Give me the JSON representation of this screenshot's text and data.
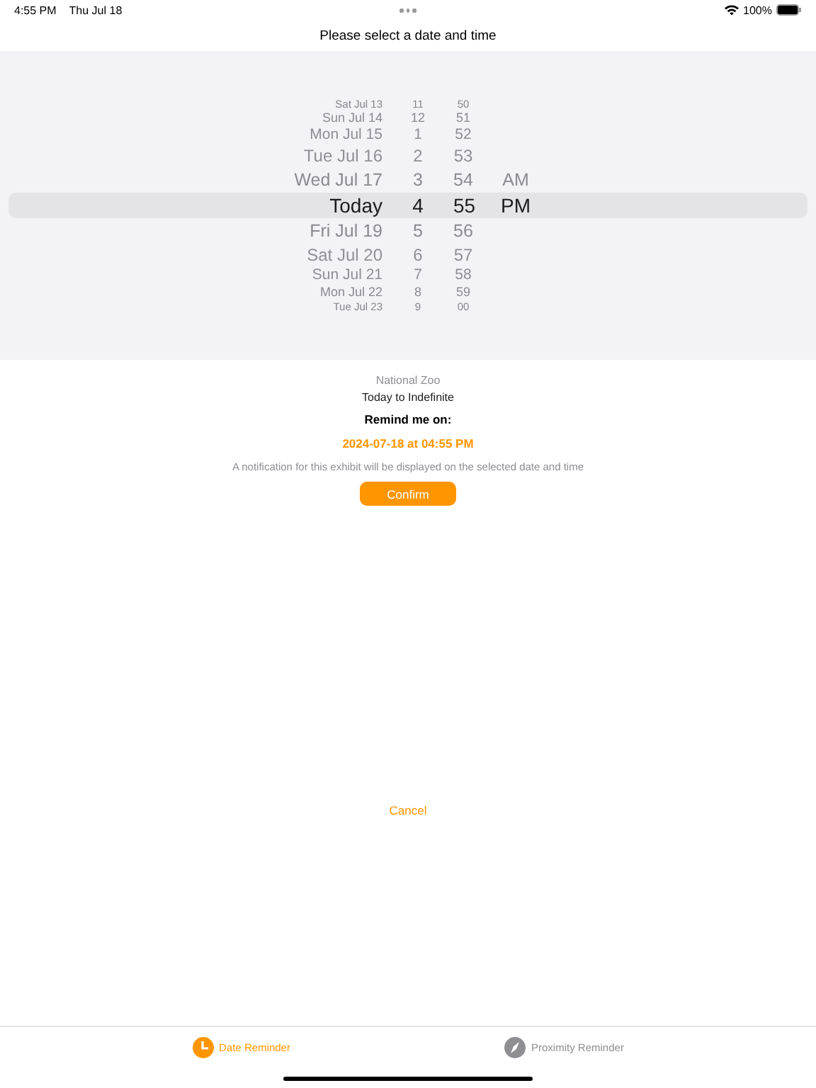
{
  "status_bar": {
    "time": "4:55 PM",
    "date": "Thu Jul 18",
    "battery": "100%"
  },
  "title": "Please select a date and time",
  "picker": {
    "rows": [
      {
        "date": "Sat Jul 13",
        "hour": "11",
        "minute": "50",
        "period": "",
        "selected": false
      },
      {
        "date": "Sun Jul 14",
        "hour": "12",
        "minute": "51",
        "period": "",
        "selected": false
      },
      {
        "date": "Mon Jul 15",
        "hour": "1",
        "minute": "52",
        "period": "",
        "selected": false
      },
      {
        "date": "Tue Jul 16",
        "hour": "2",
        "minute": "53",
        "period": "",
        "selected": false
      },
      {
        "date": "Wed Jul 17",
        "hour": "3",
        "minute": "54",
        "period": "AM",
        "selected": false
      },
      {
        "date": "Today",
        "hour": "4",
        "minute": "55",
        "period": "PM",
        "selected": true
      },
      {
        "date": "Fri Jul 19",
        "hour": "5",
        "minute": "56",
        "period": "",
        "selected": false
      },
      {
        "date": "Sat Jul 20",
        "hour": "6",
        "minute": "57",
        "period": "",
        "selected": false
      },
      {
        "date": "Sun Jul 21",
        "hour": "7",
        "minute": "58",
        "period": "",
        "selected": false
      },
      {
        "date": "Mon Jul 22",
        "hour": "8",
        "minute": "59",
        "period": "",
        "selected": false
      },
      {
        "date": "Tue Jul 23",
        "hour": "9",
        "minute": "00",
        "period": "",
        "selected": false
      }
    ]
  },
  "exhibit": {
    "name": "National Zoo",
    "range": "Today to Indefinite"
  },
  "remind_label": "Remind me on:",
  "remind_value": "2024-07-18 at 04:55 PM",
  "note": "A notification for this exhibit will be displayed on the selected date and time",
  "confirm": "Confirm",
  "cancel": "Cancel",
  "tabs": [
    {
      "label": "Date Reminder",
      "kind": "clock",
      "selected": true
    },
    {
      "label": "Proximity Reminder",
      "kind": "compass",
      "selected": false
    }
  ]
}
